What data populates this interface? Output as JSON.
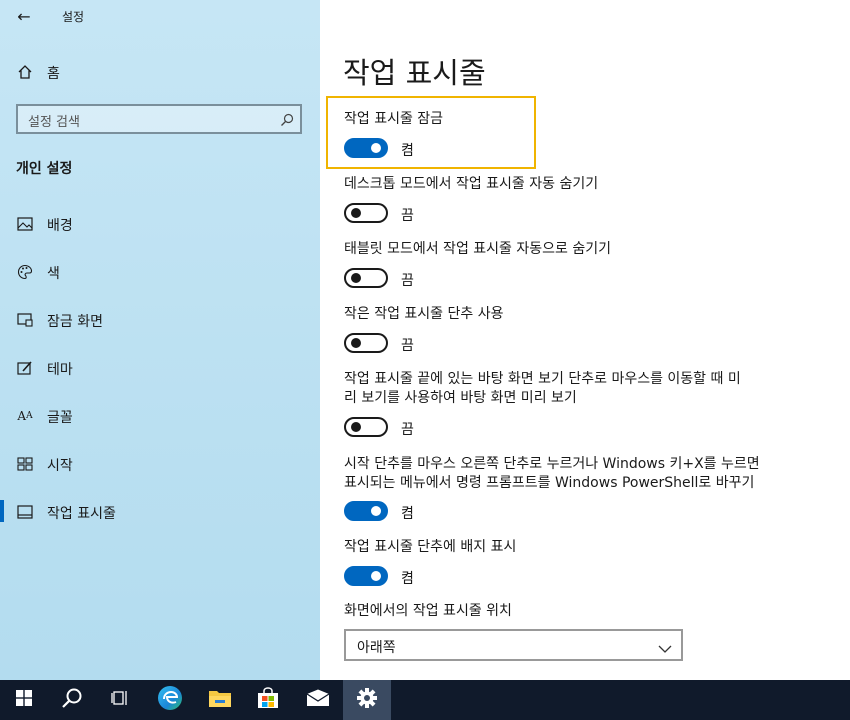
{
  "window": {
    "title": "설정"
  },
  "sidebar": {
    "home_label": "홈",
    "search_placeholder": "설정 검색",
    "section_title": "개인 설정",
    "items": [
      {
        "label": "배경",
        "icon": "image-icon"
      },
      {
        "label": "색",
        "icon": "palette-icon"
      },
      {
        "label": "잠금 화면",
        "icon": "lock-screen-icon"
      },
      {
        "label": "테마",
        "icon": "theme-brush-icon"
      },
      {
        "label": "글꼴",
        "icon": "font-icon"
      },
      {
        "label": "시작",
        "icon": "start-grid-icon"
      },
      {
        "label": "작업 표시줄",
        "icon": "taskbar-icon",
        "selected": true
      }
    ]
  },
  "main": {
    "title": "작업 표시줄",
    "settings": [
      {
        "label": "작업 표시줄 잠금",
        "state": "켬",
        "on": true
      },
      {
        "label": "데스크톱 모드에서 작업 표시줄 자동 숨기기",
        "state": "끔",
        "on": false
      },
      {
        "label": "태블릿 모드에서 작업 표시줄 자동으로 숨기기",
        "state": "끔",
        "on": false
      },
      {
        "label": "작은 작업 표시줄 단추 사용",
        "state": "끔",
        "on": false
      },
      {
        "label_line1": "작업 표시줄 끝에 있는 바탕 화면 보기 단추로 마우스를 이동할 때 미",
        "label_line2": "리 보기를 사용하여 바탕 화면 미리 보기",
        "state": "끔",
        "on": false
      },
      {
        "label_line1": "시작 단추를 마우스 오른쪽 단추로 누르거나 Windows 키+X를 누르면",
        "label_line2": "표시되는 메뉴에서 명령 프롬프트를 Windows PowerShell로 바꾸기",
        "state": "켬",
        "on": true
      },
      {
        "label": "작업 표시줄 단추에 배지 표시",
        "state": "켬",
        "on": true
      }
    ],
    "position_label": "화면에서의 작업 표시줄 위치",
    "position_value": "아래쪽"
  },
  "colors": {
    "accent": "#0067c0",
    "focus": "#f0b400",
    "taskbar": "#101a2b",
    "sidebar": "#c6e6f5"
  },
  "taskbar": {
    "icons": [
      "windows-start-icon",
      "search-icon",
      "task-view-icon",
      "edge-icon",
      "file-explorer-icon",
      "store-icon",
      "mail-icon",
      "settings-gear-icon"
    ]
  }
}
